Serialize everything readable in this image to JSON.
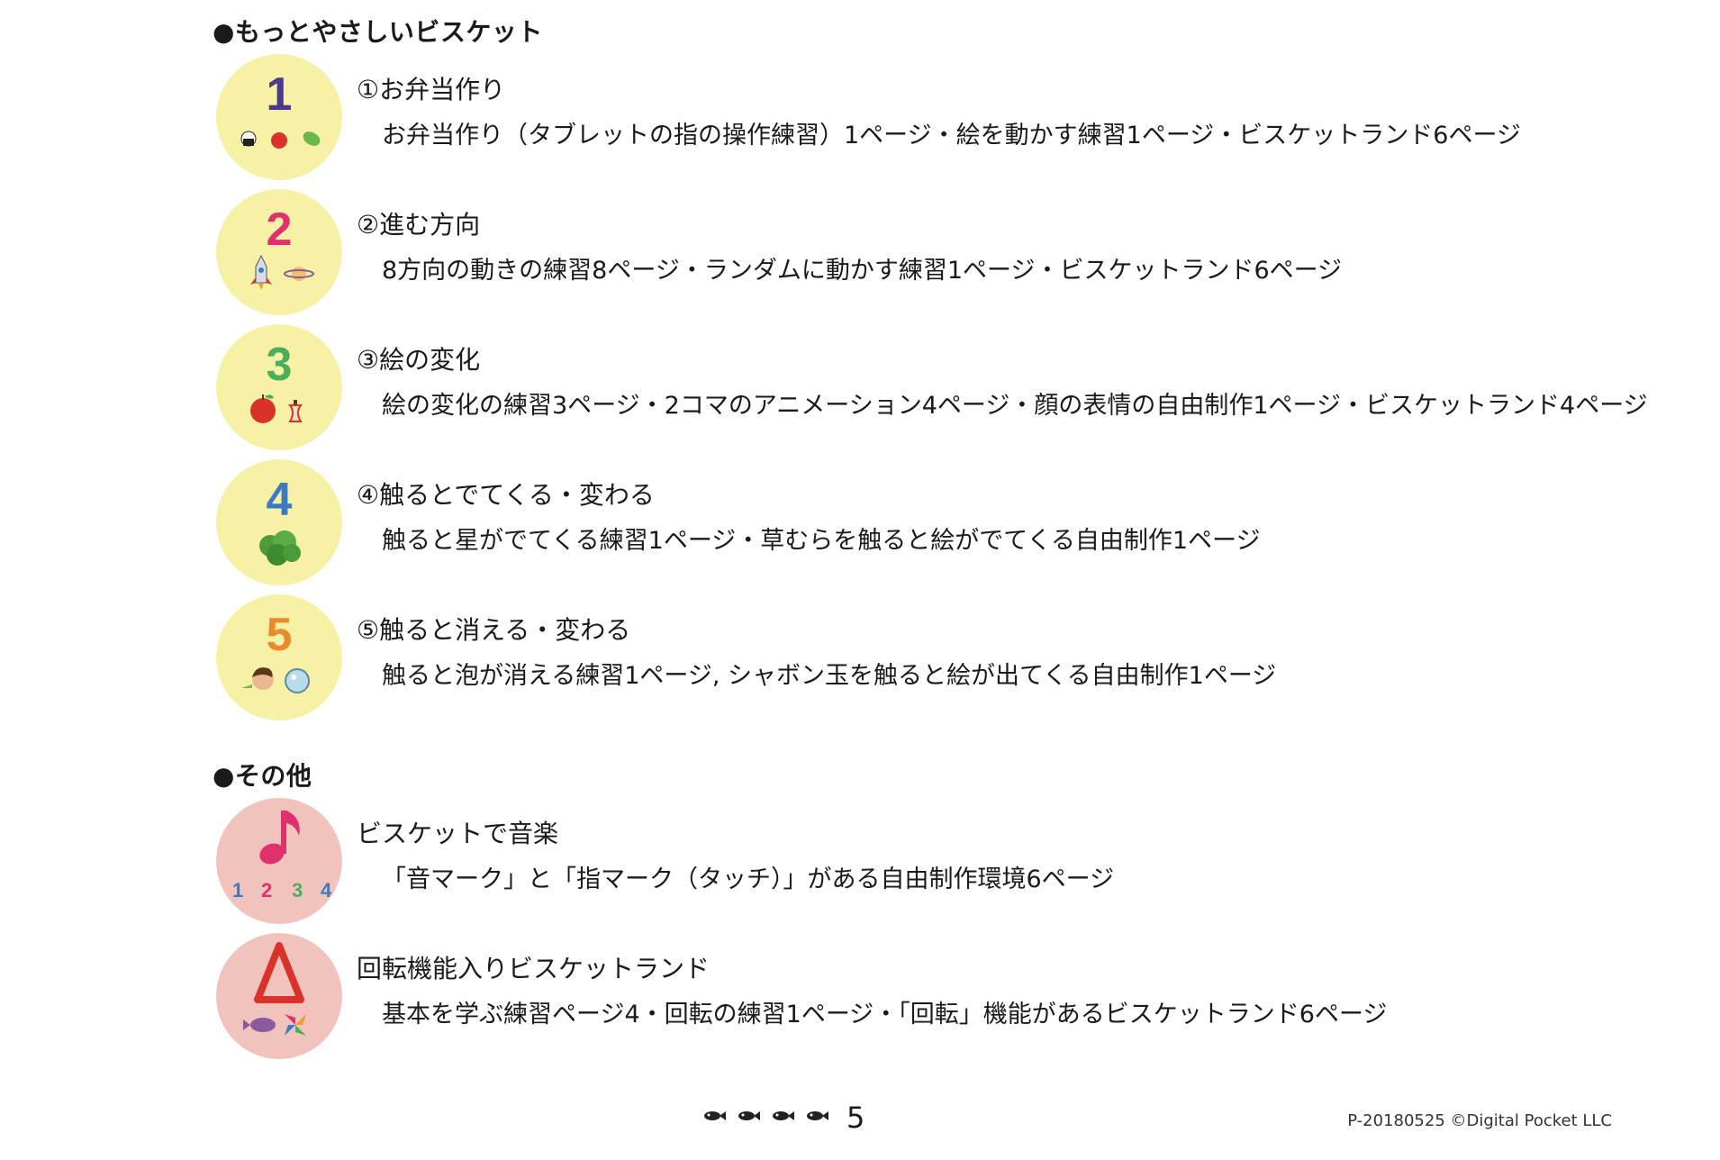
{
  "sections": [
    {
      "heading": "●もっとやさしいビスケット",
      "entries": [
        {
          "badge_number": "1",
          "badge_icon": "food-icons",
          "title": "①お弁当作り",
          "detail": "お弁当作り（タブレットの指の操作練習）1ページ・絵を動かす練習1ページ・ビスケットランド6ページ"
        },
        {
          "badge_number": "2",
          "badge_icon": "rocket-planet-icons",
          "title": "②進む方向",
          "detail": "8方向の動きの練習8ページ・ランダムに動かす練習1ページ・ビスケットランド6ページ"
        },
        {
          "badge_number": "3",
          "badge_icon": "apple-core-icons",
          "title": "③絵の変化",
          "detail": "絵の変化の練習3ページ・2コマのアニメーション4ページ・顔の表情の自由制作1ページ・ビスケットランド4ページ"
        },
        {
          "badge_number": "4",
          "badge_icon": "bush-icon",
          "title": "④触るとでてくる・変わる",
          "detail": "触ると星がでてくる練習1ページ・草むらを触ると絵がでてくる自由制作1ページ"
        },
        {
          "badge_number": "5",
          "badge_icon": "child-bubble-icons",
          "title": "⑤触ると消える・変わる",
          "detail": "触ると泡が消える練習1ページ, シャボン玉を触ると絵が出てくる自由制作1ページ"
        }
      ]
    },
    {
      "heading": "●その他",
      "entries": [
        {
          "badge_number": "",
          "badge_icon": "music-note-icon",
          "badge_digits": [
            "1",
            "2",
            "3",
            "4"
          ],
          "title": "ビスケットで音楽",
          "detail": "「音マーク」と「指マーク（タッチ）」がある自由制作環境6ページ"
        },
        {
          "badge_number": "",
          "badge_icon": "rotate-triangle-icon",
          "title": "回転機能入りビスケットランド",
          "detail": "基本を学ぶ練習ページ4・回転の練習1ページ・「回転」機能があるビスケットランド6ページ"
        }
      ]
    }
  ],
  "footer": {
    "page_number": "5",
    "copyright": "P-20180525 ©Digital Pocket LLC"
  },
  "colors": {
    "badge_yellow": "#f7f1a6",
    "badge_pink": "#f2c3bd",
    "num1": "#4a3a8c",
    "num2": "#e0306e",
    "num3": "#4cae5a",
    "num4": "#3a7cc4",
    "num5": "#e98a2e"
  }
}
